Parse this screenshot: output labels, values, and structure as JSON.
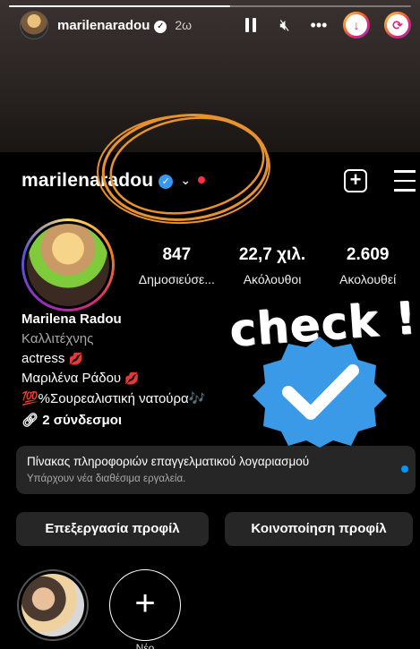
{
  "story": {
    "username": "marilenaradou",
    "time": "2ω",
    "progress": 0.55
  },
  "profile": {
    "username": "marilenaradou",
    "stats": [
      {
        "value": "847",
        "label": "Δημοσιεύσε..."
      },
      {
        "value": "22,7 χιλ.",
        "label": "Ακόλουθοι"
      },
      {
        "value": "2.609",
        "label": "Ακολουθεί"
      }
    ],
    "bio": {
      "name": "Marilena Radou",
      "category": "Καλλιτέχνης",
      "line1": "actress",
      "line2": "Μαριλένα Ράδου",
      "line3": "💯%Σουρεαλιστική νατούρα🎶",
      "links": "2 σύνδεσμοι"
    },
    "dashboard": {
      "title": "Πίνακας πληροφοριών επαγγελματικού λογαριασμού",
      "subtitle": "Υπάρχουν νέα διαθέσιμα εργαλεία."
    },
    "buttons": {
      "edit": "Επεξεργασία προφίλ",
      "share": "Κοινοποίηση προφίλ"
    },
    "highlights": {
      "new_label": "Νέο"
    }
  },
  "overlays": {
    "check_text": "check !"
  },
  "colors": {
    "verified_blue": "#3897f0",
    "scribble_orange": "#e8922e",
    "button_bg": "#262626"
  }
}
